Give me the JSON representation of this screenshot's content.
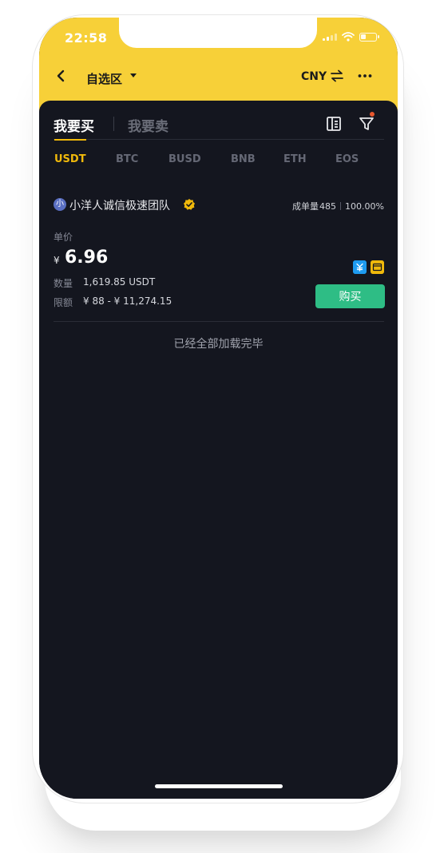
{
  "status_bar": {
    "time": "22:58"
  },
  "topbar": {
    "title": "自选区",
    "currency": "CNY"
  },
  "mode_tabs": {
    "buy": "我要买",
    "sell": "我要卖"
  },
  "coin_tabs": [
    "USDT",
    "BTC",
    "BUSD",
    "BNB",
    "ETH",
    "EOS"
  ],
  "active_coin": "USDT",
  "listing": {
    "avatar_letter": "小",
    "merchant": "小洋人诚信极速团队",
    "orders_label": "成单量",
    "orders_count": "485",
    "completion": "100.00%",
    "price_label": "单价",
    "price_symbol": "¥",
    "price": "6.96",
    "quantity_label": "数量",
    "quantity_value": "1,619.85 USDT",
    "limit_label": "限额",
    "limit_value": "¥ 88 - ¥ 11,274.15",
    "buy_label": "购买",
    "payment_methods": [
      "alipay-icon",
      "bank-card-icon"
    ]
  },
  "end_note": "已经全部加载完毕",
  "colors": {
    "brand_yellow": "#f7d038",
    "accent": "#f0b90b",
    "buy_green": "#2ebd85",
    "background": "#14161f"
  }
}
